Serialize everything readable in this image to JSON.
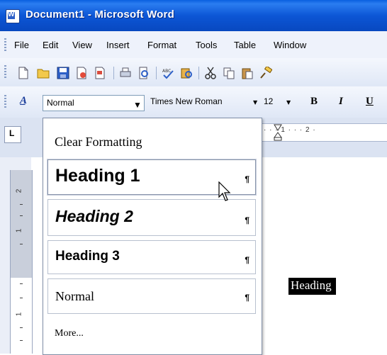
{
  "window": {
    "title": "Document1 - Microsoft Word"
  },
  "menu": [
    "File",
    "Edit",
    "View",
    "Insert",
    "Format",
    "Tools",
    "Table",
    "Window"
  ],
  "formatting": {
    "style_value": "Normal",
    "font_value": "Times New Roman",
    "size_value": "12",
    "bold_label": "B",
    "italic_label": "I",
    "underline_label": "U"
  },
  "ruler": {
    "marks": "· · · 1 · · · 2 ·"
  },
  "vruler": {
    "n1": "2",
    "n2": "1",
    "n3": "1"
  },
  "style_list": {
    "items": [
      {
        "label": "Clear Formatting",
        "mark": ""
      },
      {
        "label": "Heading 1",
        "mark": "¶"
      },
      {
        "label": "Heading 2",
        "mark": "¶"
      },
      {
        "label": "Heading 3",
        "mark": "¶"
      },
      {
        "label": "Normal",
        "mark": "¶"
      }
    ],
    "more_label": "More..."
  },
  "document": {
    "selected_text": "Heading"
  },
  "colors": {
    "titlebar": "#0c56d6",
    "selection": "#000000"
  }
}
